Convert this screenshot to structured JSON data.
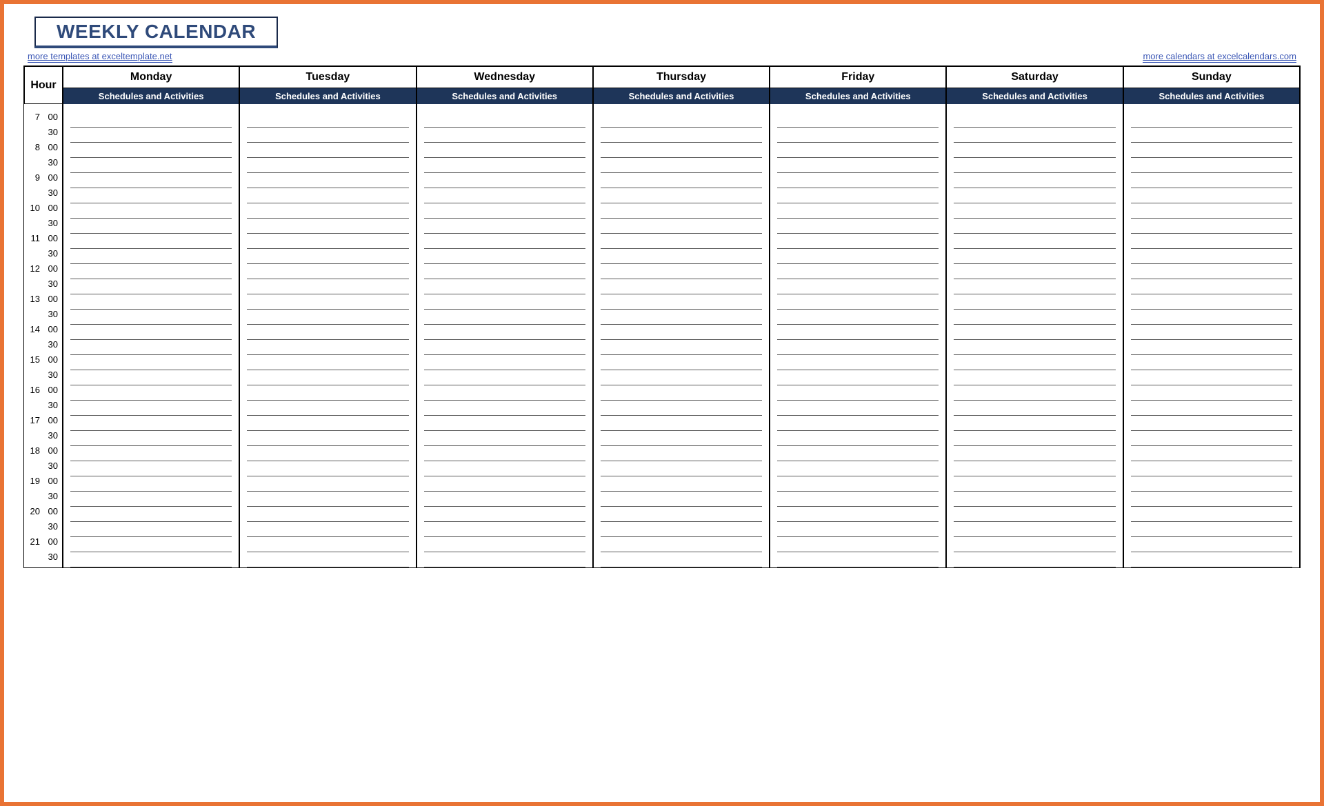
{
  "title": "WEEKLY CALENDAR",
  "links": {
    "left": "more templates at exceltemplate.net",
    "right": "more calendars at excelcalendars.com"
  },
  "headers": {
    "hour": "Hour",
    "days": [
      "Monday",
      "Tuesday",
      "Wednesday",
      "Thursday",
      "Friday",
      "Saturday",
      "Sunday"
    ],
    "sub": "Schedules and Activities"
  },
  "hours": [
    7,
    8,
    9,
    10,
    11,
    12,
    13,
    14,
    15,
    16,
    17,
    18,
    19,
    20,
    21
  ],
  "minutes": [
    "00",
    "30"
  ]
}
